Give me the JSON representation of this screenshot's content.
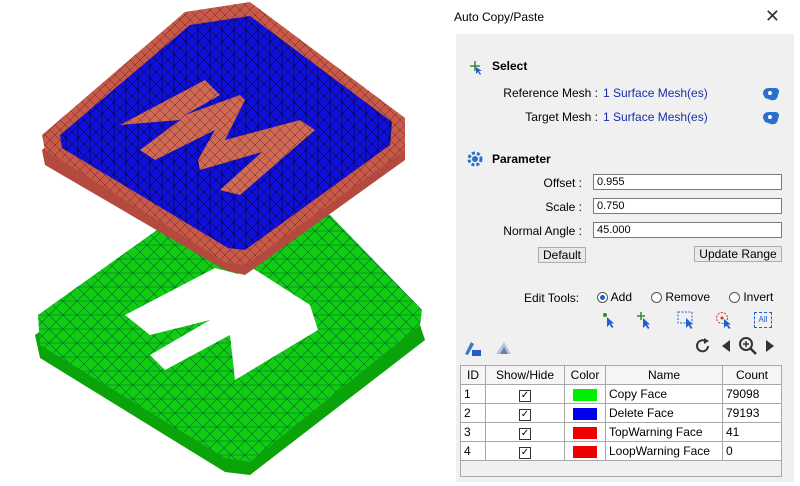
{
  "dialog": {
    "title": "Auto Copy/Paste",
    "close_glyph": "✕"
  },
  "select": {
    "heading": "Select",
    "reference_label": "Reference Mesh :",
    "reference_value": "1 Surface Mesh(es)",
    "target_label": "Target Mesh :",
    "target_value": "1 Surface Mesh(es)"
  },
  "parameter": {
    "heading": "Parameter",
    "offset_label": "Offset :",
    "offset_value": "0.955",
    "scale_label": "Scale :",
    "scale_value": "0.750",
    "angle_label": "Normal Angle :",
    "angle_value": "45.000",
    "default_button": "Default",
    "update_button": "Update Range"
  },
  "edit_tools": {
    "label": "Edit Tools:",
    "options": [
      "Add",
      "Remove",
      "Invert"
    ],
    "selected": "Add",
    "icons": [
      "select-point-icon",
      "select-cross-icon",
      "box-select-icon",
      "brush-select-icon",
      "select-all-icon"
    ],
    "all_label": "All"
  },
  "table": {
    "headers": [
      "ID",
      "Show/Hide",
      "Color",
      "Name",
      "Count"
    ],
    "rows": [
      {
        "id": "1",
        "checked": "✓",
        "color": "#00ee00",
        "name": "Copy Face",
        "count": "79098"
      },
      {
        "id": "2",
        "checked": "✓",
        "color": "#0000ee",
        "name": "Delete Face",
        "count": "79193"
      },
      {
        "id": "3",
        "checked": "✓",
        "color": "#ee0000",
        "name": "TopWarning Face",
        "count": "41"
      },
      {
        "id": "4",
        "checked": "✓",
        "color": "#ee0000",
        "name": "LoopWarning Face",
        "count": "0"
      }
    ]
  },
  "colors": {
    "accent": "#1f5fd0",
    "link": "#1a2ea8",
    "mesh_red": "#c85a4a",
    "mesh_blue": "#1010d8",
    "mesh_green": "#10c810"
  }
}
